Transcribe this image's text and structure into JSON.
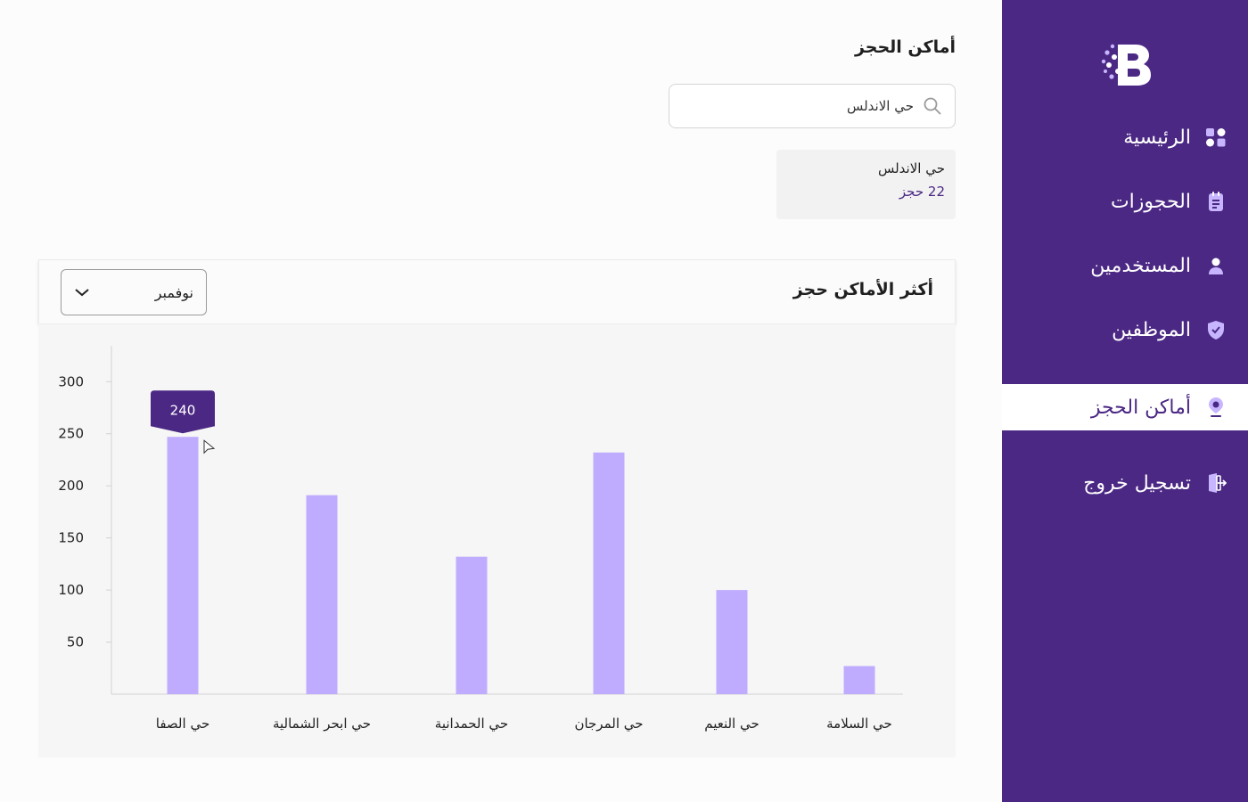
{
  "sidebar": {
    "logo_icon": "brand-b-logo-icon",
    "bg_color": "#4b2884",
    "items": [
      {
        "label": "الرئيسية",
        "icon": "dashboard-grid-icon",
        "active": false
      },
      {
        "label": "الحجوزات",
        "icon": "clipboard-icon",
        "active": false
      },
      {
        "label": "المستخدمين",
        "icon": "user-icon",
        "active": false
      },
      {
        "label": "الموظفين",
        "icon": "shield-check-icon",
        "active": false
      },
      {
        "label": "أماكن الحجز",
        "icon": "location-pin-icon",
        "active": true
      },
      {
        "label": "تسجيل خروج",
        "icon": "logout-door-icon",
        "active": false
      }
    ]
  },
  "page": {
    "title": "أماكن الحجز"
  },
  "search": {
    "value": "حي الاندلس",
    "icon": "search-icon"
  },
  "result": {
    "name": "حي الاندلس",
    "count": "22 حجز"
  },
  "chart_panel": {
    "title": "أكثر الأماكن حجز",
    "month_selected": "نوفمبر",
    "dropdown_icon": "chevron-down-icon"
  },
  "chart_data": {
    "type": "bar",
    "categories": [
      "حي الصفا",
      "حي ابحر الشمالية",
      "حي الحمدانية",
      "حي المرجان",
      "حي النعيم",
      "حي السلامة"
    ],
    "values": [
      247,
      191,
      132,
      232,
      100,
      27
    ],
    "yticks": [
      50,
      100,
      150,
      200,
      250,
      300
    ],
    "ylim": [
      0,
      355
    ],
    "bar_color": "#c0acfe",
    "tooltip": {
      "category": "حي الصفا",
      "label": "240",
      "color": "#4b2884"
    },
    "grid": false
  }
}
